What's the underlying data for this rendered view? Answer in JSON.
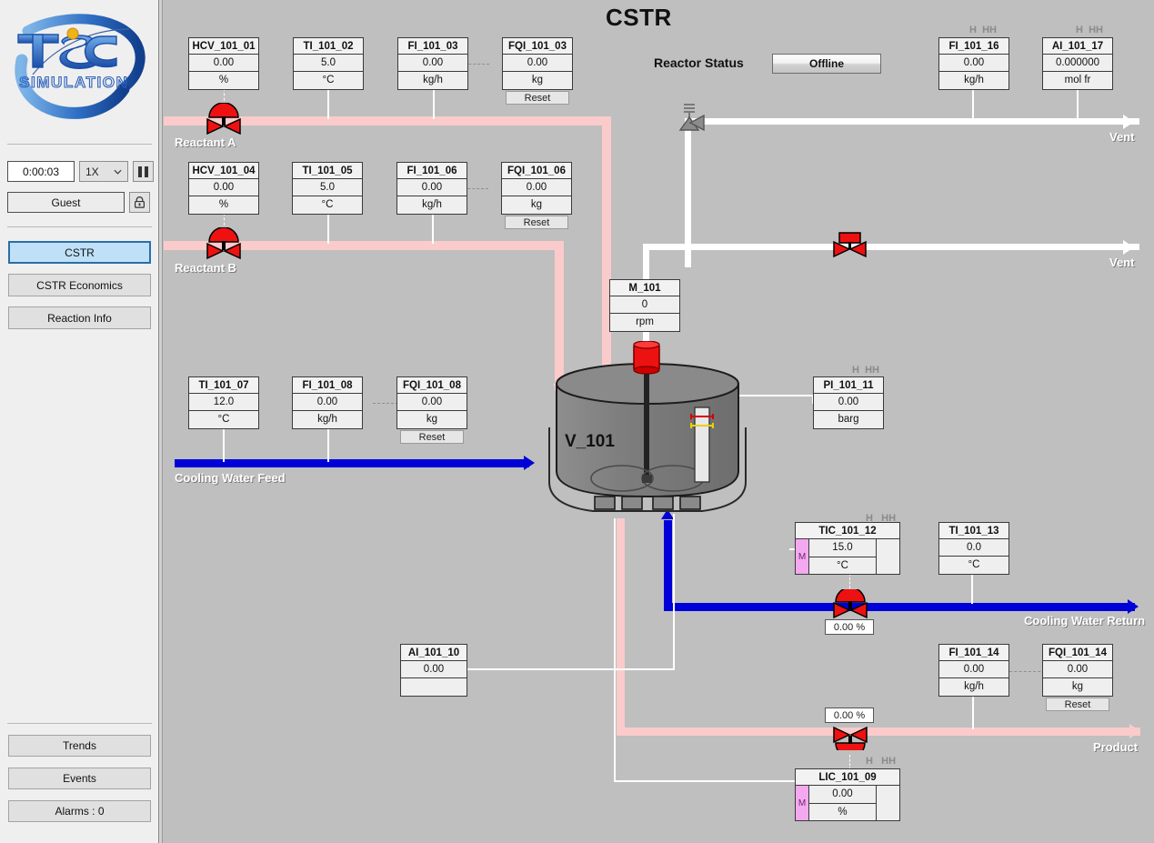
{
  "app": {
    "logo_primary": "TSC",
    "logo_secondary": "SIMULATION"
  },
  "sidebar": {
    "sim_time": "0:00:03",
    "speed": "1X",
    "speed_options": [
      "1X"
    ],
    "pause_icon": "pause-icon",
    "user": "Guest",
    "lock_icon": "lock-icon",
    "nav": [
      {
        "label": "CSTR",
        "active": true
      },
      {
        "label": "CSTR Economics",
        "active": false
      },
      {
        "label": "Reaction Info",
        "active": false
      }
    ],
    "bottom": [
      {
        "label": "Trends"
      },
      {
        "label": "Events"
      },
      {
        "label": "Alarms : 0"
      }
    ]
  },
  "header": {
    "title": "CSTR",
    "reactor_status_label": "Reactor Status",
    "reactor_status_value": "Offline"
  },
  "colors": {
    "pipe_reactant": "#fbcbcb",
    "pipe_vent": "#ffffff",
    "pipe_cooling": "#0000d8",
    "valve_red": "#ee1111",
    "mode_manual": "#f3a8ef",
    "accent_selected": "#bfe0f7",
    "background": "#bfbfbf"
  },
  "alarm_marks": {
    "h": "H",
    "hh": "HH"
  },
  "reset_label": "Reset",
  "tags": {
    "hcv_101_01": {
      "name": "HCV_101_01",
      "value": "0.00",
      "unit": "%"
    },
    "ti_101_02": {
      "name": "TI_101_02",
      "value": "5.0",
      "unit": "°C"
    },
    "fi_101_03": {
      "name": "FI_101_03",
      "value": "0.00",
      "unit": "kg/h"
    },
    "fqi_101_03": {
      "name": "FQI_101_03",
      "value": "0.00",
      "unit": "kg"
    },
    "hcv_101_04": {
      "name": "HCV_101_04",
      "value": "0.00",
      "unit": "%"
    },
    "ti_101_05": {
      "name": "TI_101_05",
      "value": "5.0",
      "unit": "°C"
    },
    "fi_101_06": {
      "name": "FI_101_06",
      "value": "0.00",
      "unit": "kg/h"
    },
    "fqi_101_06": {
      "name": "FQI_101_06",
      "value": "0.00",
      "unit": "kg"
    },
    "ti_101_07": {
      "name": "TI_101_07",
      "value": "12.0",
      "unit": "°C"
    },
    "fi_101_08": {
      "name": "FI_101_08",
      "value": "0.00",
      "unit": "kg/h"
    },
    "fqi_101_08": {
      "name": "FQI_101_08",
      "value": "0.00",
      "unit": "kg"
    },
    "ai_101_10": {
      "name": "AI_101_10",
      "value": "0.00",
      "unit": ""
    },
    "pi_101_11": {
      "name": "PI_101_11",
      "value": "0.00",
      "unit": "barg"
    },
    "ti_101_13": {
      "name": "TI_101_13",
      "value": "0.0",
      "unit": "°C"
    },
    "fi_101_14": {
      "name": "FI_101_14",
      "value": "0.00",
      "unit": "kg/h"
    },
    "fqi_101_14": {
      "name": "FQI_101_14",
      "value": "0.00",
      "unit": "kg"
    },
    "fi_101_16": {
      "name": "FI_101_16",
      "value": "0.00",
      "unit": "kg/h"
    },
    "ai_101_17": {
      "name": "AI_101_17",
      "value": "0.000000",
      "unit": "mol fr"
    },
    "m_101": {
      "name": "M_101",
      "value": "0",
      "unit": "rpm"
    }
  },
  "controllers": {
    "tic_101_12": {
      "name": "TIC_101_12",
      "value": "15.0",
      "unit": "°C",
      "mode": "M"
    },
    "lic_101_09": {
      "name": "LIC_101_09",
      "value": "0.00",
      "unit": "%",
      "mode": "M"
    }
  },
  "valve_readouts": {
    "cooling_return": "0.00 %",
    "product": "0.00 %"
  },
  "vessel": {
    "label": "V_101"
  },
  "stream_labels": {
    "reactant_a": "Reactant A",
    "reactant_b": "Reactant B",
    "cooling_water_feed": "Cooling Water Feed",
    "cooling_water_return": "Cooling Water Return",
    "vent_top": "Vent",
    "vent_mid": "Vent",
    "product": "Product"
  }
}
